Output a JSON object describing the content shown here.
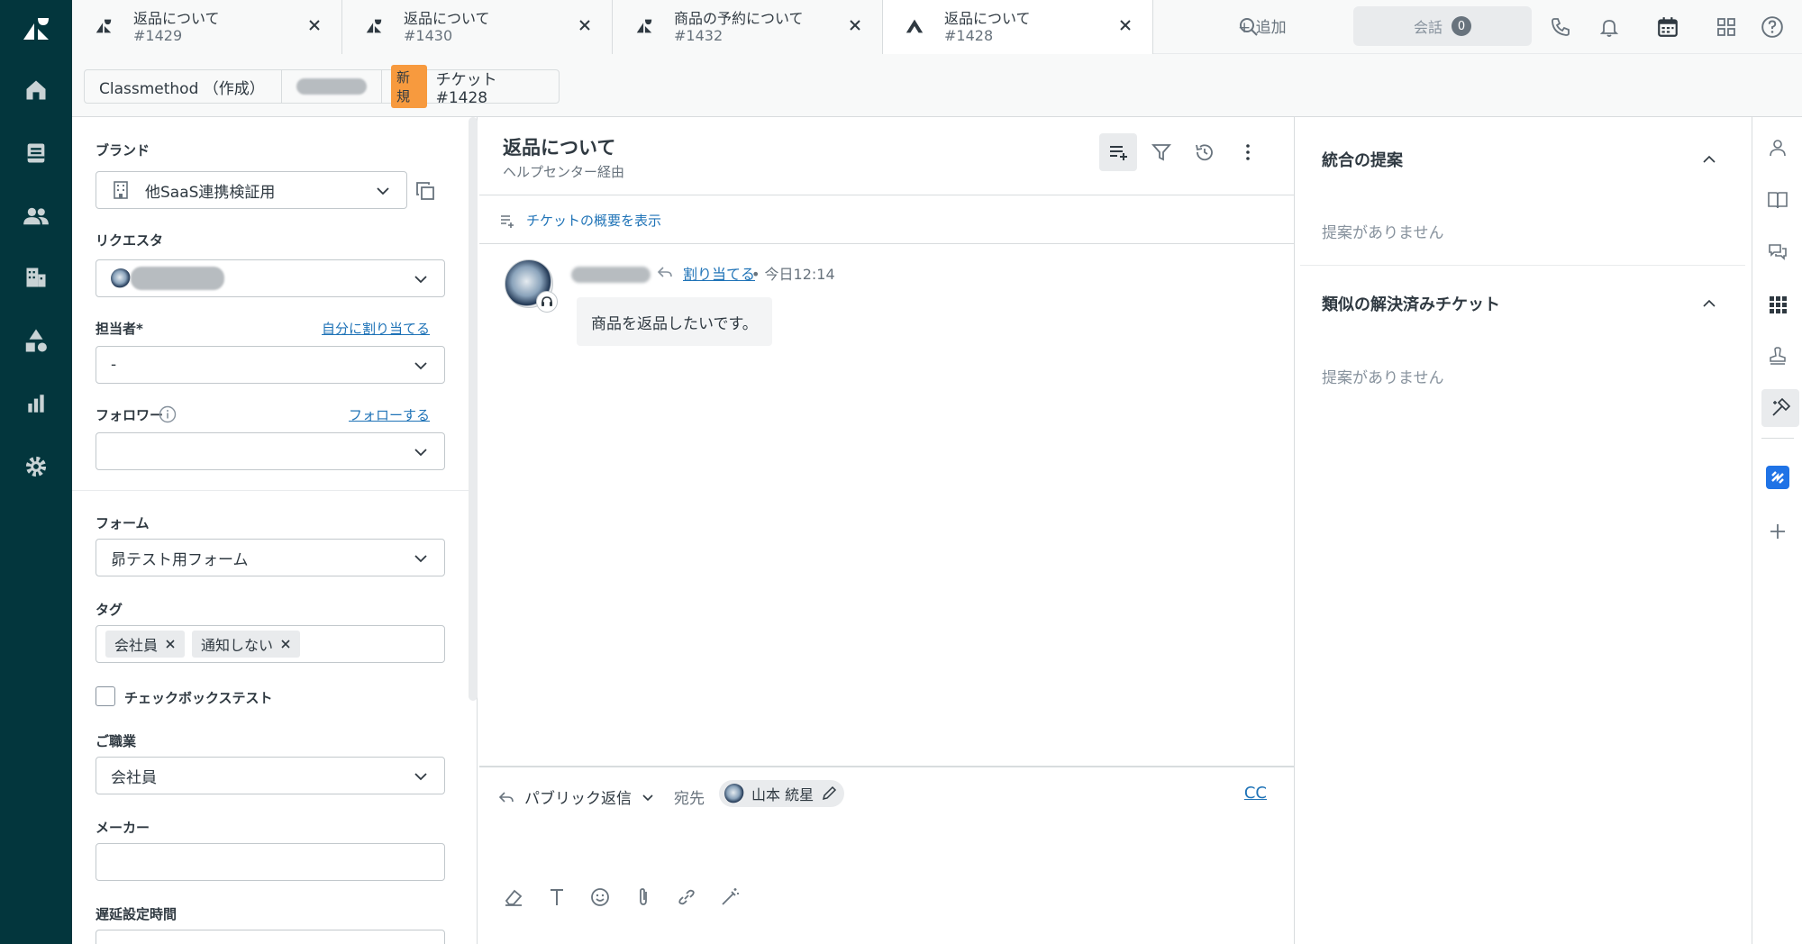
{
  "tabs": [
    {
      "title": "返品について",
      "number": "#1429"
    },
    {
      "title": "返品について",
      "number": "#1430"
    },
    {
      "title": "商品の予約について",
      "number": "#1432"
    },
    {
      "title": "返品について",
      "number": "#1428"
    }
  ],
  "topbar": {
    "add_label": "+ 追加",
    "conversations_label": "会話",
    "conversations_count": "0"
  },
  "breadcrumb": {
    "org": "Classmethod （作成）",
    "status_badge": "新規",
    "ticket": "チケット #1428"
  },
  "left_panel": {
    "brand_label": "ブランド",
    "brand_value": "他SaaS連携検証用",
    "requester_label": "リクエスタ",
    "assignee_label": "担当者*",
    "assign_self_link": "自分に割り当てる",
    "assignee_value": "-",
    "followers_label": "フォロワー",
    "follow_link": "フォローする",
    "form_label": "フォーム",
    "form_value": "昴テスト用フォーム",
    "tags_label": "タグ",
    "tags": [
      "会社員",
      "通知しない"
    ],
    "checkbox_label": "チェックボックステスト",
    "occupation_label": "ご職業",
    "occupation_value": "会社員",
    "maker_label": "メーカー",
    "maker_value": "",
    "delay_label": "遅延設定時間"
  },
  "ticket": {
    "title": "返品について",
    "channel": "ヘルプセンター経由",
    "summary_link": "チケットの概要を表示",
    "assign_link": "割り当てる",
    "time": "•  今日12:14",
    "message": "商品を返品したいです。"
  },
  "composer": {
    "reply_type": "パブリック返信",
    "to_label": "宛先",
    "recipient": "山本 統星",
    "cc_label": "CC"
  },
  "context_panel": {
    "merge_title": "統合の提案",
    "merge_empty": "提案がありません",
    "similar_title": "類似の解決済みチケット",
    "similar_empty": "提案がありません"
  },
  "colors": {
    "rail": "#03363d",
    "link": "#1f73b7",
    "new_badge": "#f79a3e",
    "app_blue": "#1f73e6"
  }
}
